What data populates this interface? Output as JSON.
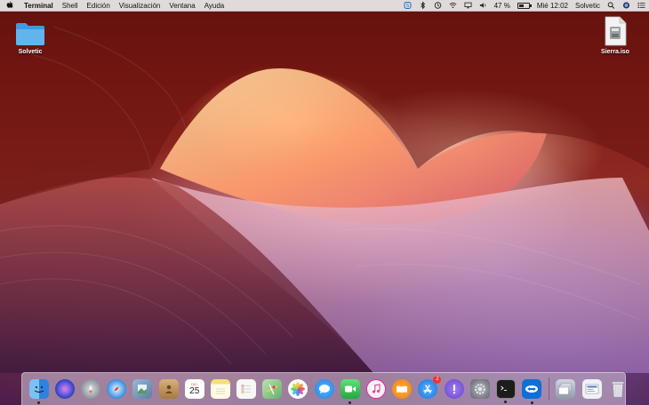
{
  "menubar": {
    "apple": "",
    "items": [
      "Terminal",
      "Shell",
      "Edición",
      "Visualización",
      "Ventana",
      "Ayuda"
    ],
    "status": {
      "battery_percent": "47 %",
      "battery_level": 0.47,
      "clock": "Mié 12:02",
      "user": "Solvetic"
    }
  },
  "desktop": {
    "icons": [
      {
        "label": "Solvetic",
        "icon": "folder-icon"
      },
      {
        "label": "Sierra.iso",
        "icon": "disk-image-icon"
      }
    ]
  },
  "dock": {
    "calendar_day": "25",
    "calendar_month": "DIC",
    "appstore_badge": "2",
    "apps": [
      {
        "name": "Finder",
        "icon": "finder-icon",
        "color": "#3d8ce8"
      },
      {
        "name": "Siri",
        "icon": "siri-icon",
        "color": "#4a3a9a"
      },
      {
        "name": "Launchpad",
        "icon": "launchpad-icon",
        "color": "#8a8f98"
      },
      {
        "name": "Safari",
        "icon": "safari-icon",
        "color": "#2f8de0"
      },
      {
        "name": "Preview",
        "icon": "preview-icon",
        "color": "#6c8fb0"
      },
      {
        "name": "Contacts",
        "icon": "contacts-icon",
        "color": "#c49a5a"
      },
      {
        "name": "Calendar",
        "icon": "calendar-icon",
        "color": "#ffffff"
      },
      {
        "name": "Notes",
        "icon": "notes-icon",
        "color": "#f7e08a"
      },
      {
        "name": "Reminders",
        "icon": "reminders-icon",
        "color": "#f4f4f4"
      },
      {
        "name": "Maps",
        "icon": "maps-icon",
        "color": "#7fbf7f"
      },
      {
        "name": "Photos",
        "icon": "photos-icon",
        "color": "#ffffff"
      },
      {
        "name": "Messages",
        "icon": "messages-icon",
        "color": "#2e9ef5"
      },
      {
        "name": "FaceTime",
        "icon": "facetime-icon",
        "color": "#34c759"
      },
      {
        "name": "iTunes",
        "icon": "itunes-icon",
        "color": "#e94b9a"
      },
      {
        "name": "iBooks",
        "icon": "ibooks-icon",
        "color": "#f5931f"
      },
      {
        "name": "App Store",
        "icon": "appstore-icon",
        "color": "#2a7ff3"
      },
      {
        "name": "Feedback",
        "icon": "feedback-icon",
        "color": "#7a4fd6"
      },
      {
        "name": "System Preferences",
        "icon": "gear-icon",
        "color": "#7b7f86"
      },
      {
        "name": "Terminal",
        "icon": "terminal-icon",
        "color": "#1c1c1c"
      },
      {
        "name": "TeamViewer",
        "icon": "teamviewer-icon",
        "color": "#0e6fd6"
      }
    ],
    "docs": [
      {
        "name": "Screenshot stack",
        "icon": "document-stack-icon",
        "color": "#aeb6c4"
      },
      {
        "name": "Image",
        "icon": "image-document-icon",
        "color": "#e9ecf1"
      },
      {
        "name": "Trash",
        "icon": "trash-icon",
        "color": "#d6dae0"
      }
    ]
  }
}
